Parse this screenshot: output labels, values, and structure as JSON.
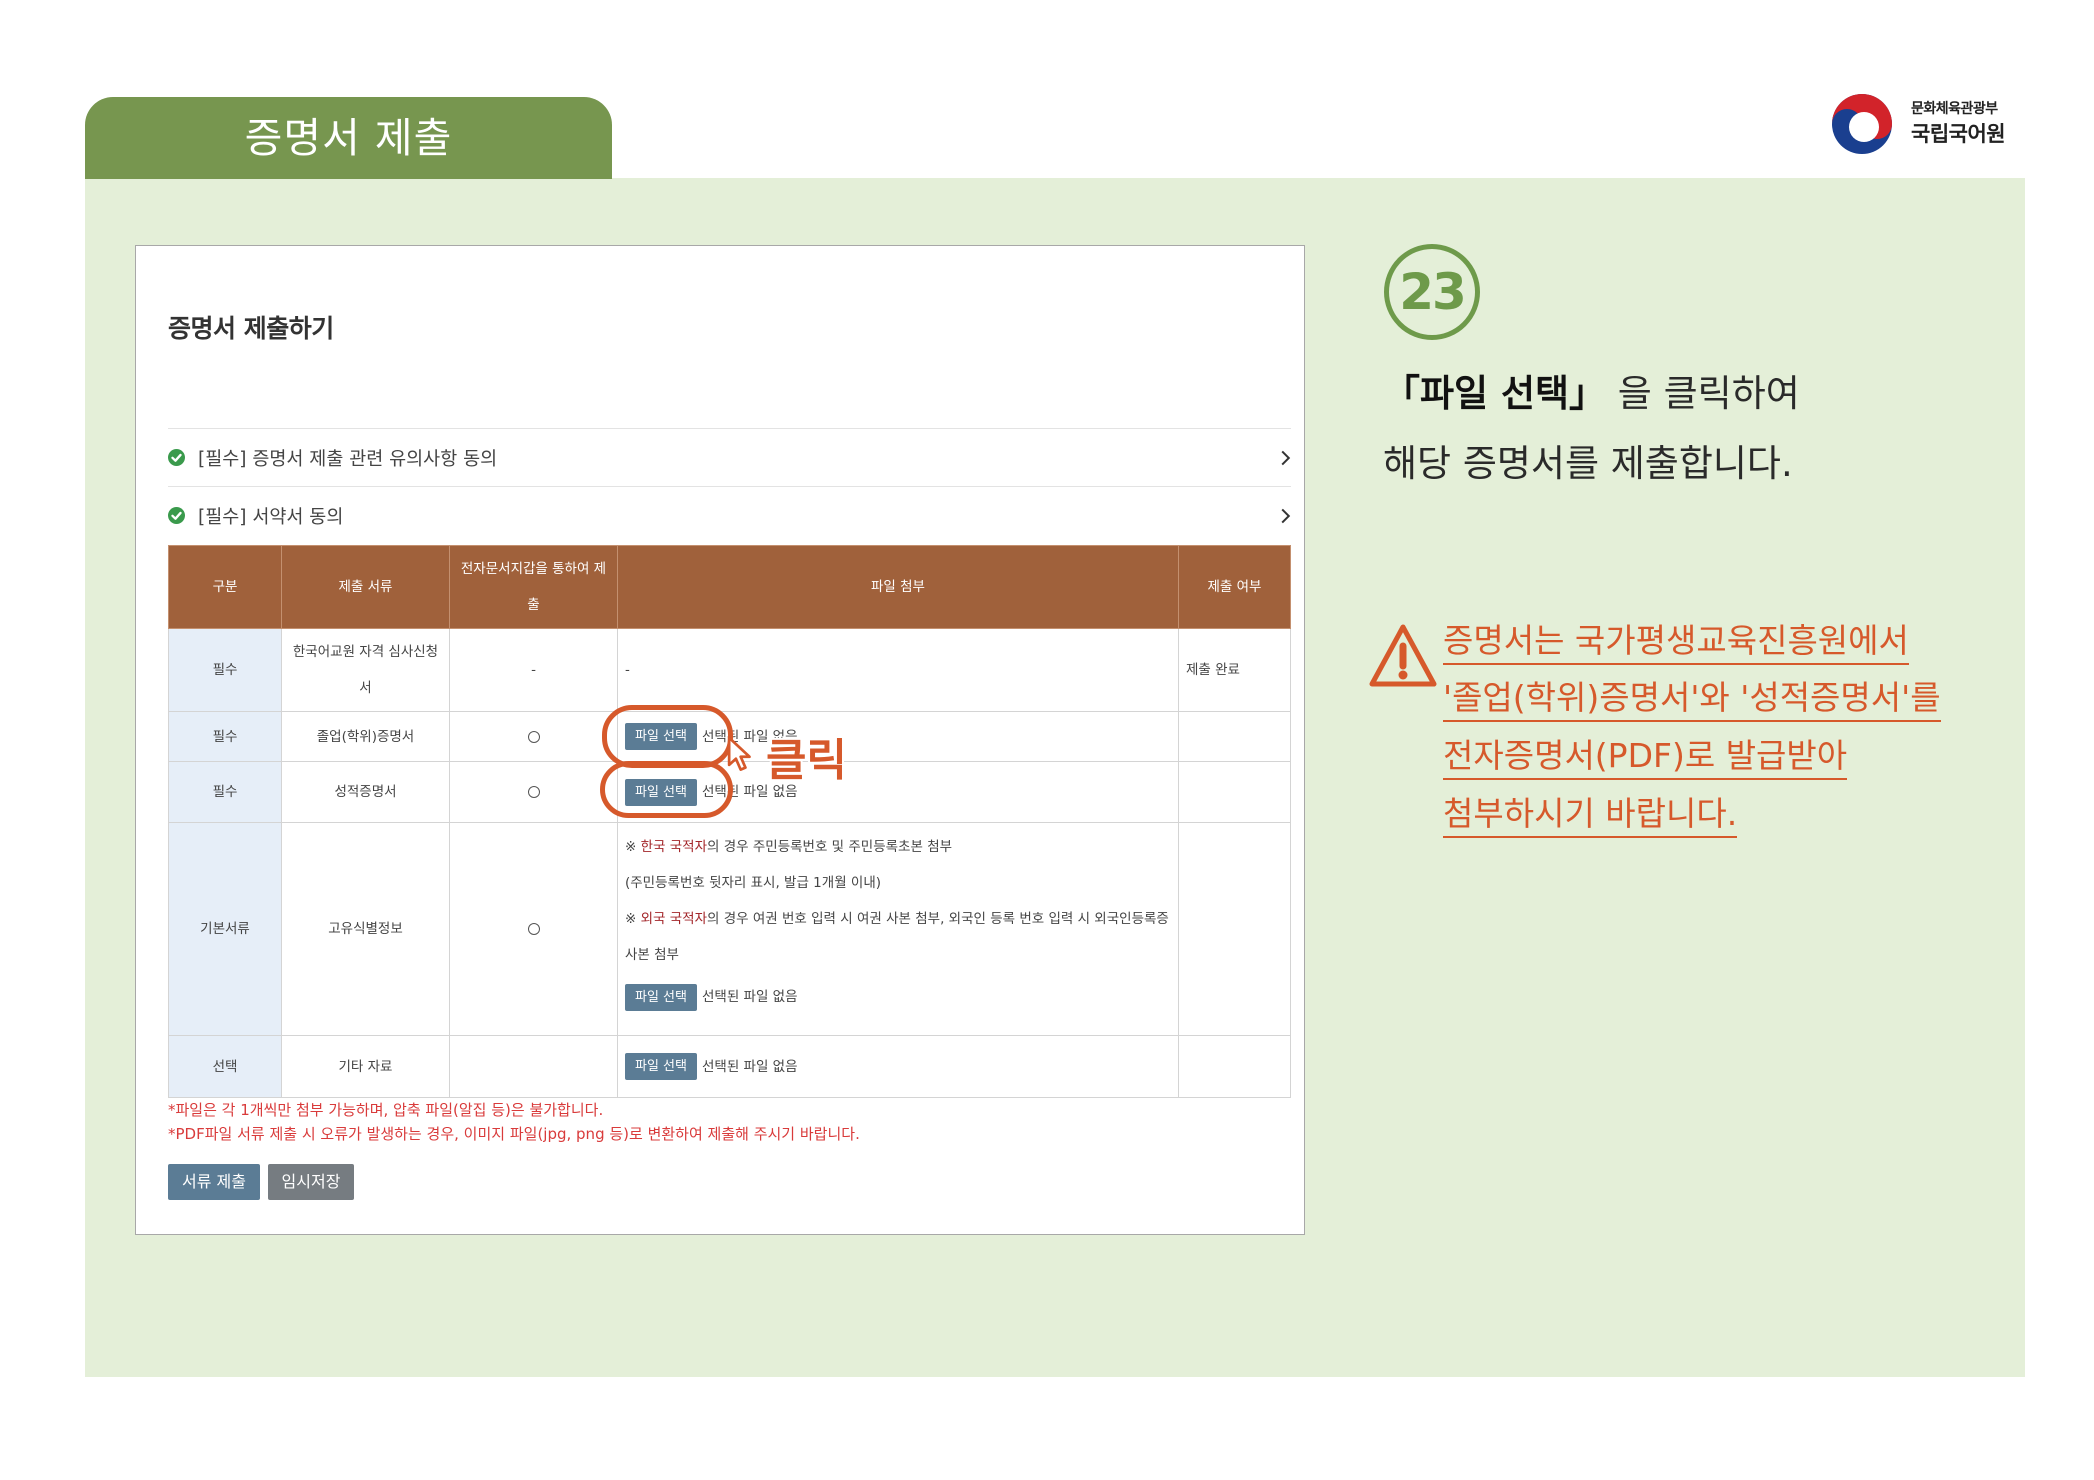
{
  "header": {
    "title": "증명서 제출"
  },
  "logo": {
    "ministry": "문화체육관광부",
    "institute": "국립국어원",
    "icon": "government-emblem-icon"
  },
  "screenshot": {
    "heading": "증명서 제출하기",
    "agreements": [
      {
        "label": "[필수] 증명서 제출 관련 유의사항 동의",
        "icon": "check-circle-icon"
      },
      {
        "label": "[필수] 서약서 동의",
        "icon": "check-circle-icon"
      }
    ],
    "table": {
      "headers": [
        "구분",
        "제출 서류",
        "전자문서지갑을 통하여 제출",
        "파일 첨부",
        "제출 여부"
      ],
      "rows": [
        {
          "category": "필수",
          "document": "한국어교원 자격 심사신청서",
          "wallet": "-",
          "attachment": "-",
          "status": "제출 완료"
        },
        {
          "category": "필수",
          "document": "졸업(학위)증명서",
          "wallet_selected": false,
          "file_button": "파일 선택",
          "file_status": "선택된 파일 없음"
        },
        {
          "category": "필수",
          "document": "성적증명서",
          "wallet_selected": false,
          "file_button": "파일 선택",
          "file_status": "선택된 파일 없음"
        },
        {
          "category": "기본서류",
          "document": "고유식별정보",
          "wallet_selected": false,
          "notes": [
            {
              "prefix": "※ ",
              "highlight": "한국 국적자",
              "rest": "의 경우 주민등록번호 및 주민등록초본 첨부"
            },
            {
              "text": "(주민등록번호 뒷자리 표시, 발급 1개월 이내)"
            },
            {
              "prefix": "※ ",
              "highlight": "외국 국적자",
              "rest": "의 경우 여권 번호 입력 시 여권 사본 첨부, 외국인 등록 번호 입력 시 외국인등록증 사본 첨부"
            }
          ],
          "file_button": "파일 선택",
          "file_status": "선택된 파일 없음"
        },
        {
          "category": "선택",
          "document": "기타 자료",
          "file_button": "파일 선택",
          "file_status": "선택된 파일 없음"
        }
      ]
    },
    "notices": [
      "*파일은 각 1개씩만 첨부 가능하며, 압축 파일(알집 등)은 불가합니다.",
      "*PDF파일 서류 제출 시 오류가 발생하는 경우, 이미지 파일(jpg, png 등)로 변환하여 제출해 주시기 바랍니다."
    ],
    "buttons": {
      "submit": "서류 제출",
      "save": "임시저장"
    }
  },
  "annotation": {
    "click_label": "클릭",
    "cursor_icon": "mouse-pointer-icon"
  },
  "instruction": {
    "step": "23",
    "emphasis": "「파일 선택」",
    "line1_rest": " 을 클릭하여",
    "line2": "해당 증명서를 제출합니다."
  },
  "caution": {
    "icon": "warning-triangle-icon",
    "lines": [
      "증명서는 국가평생교육진흥원에서",
      "'졸업(학위)증명서'와 '성적증명서'를",
      "전자증명서(PDF)로 발급받아",
      "첨부하시기 바랍니다."
    ]
  },
  "colors": {
    "accent_green": "#77964f",
    "panel_bg": "#e4efd8",
    "table_header": "#a0613b",
    "orange": "#d6592b",
    "button_blue": "#5b7c95",
    "button_gray": "#767c81",
    "notice_red": "#d93b3b",
    "highlight_red": "#a3262a",
    "first_col_bg": "#e6eef8",
    "check_green": "#3a9a4c",
    "step_green": "#6e9a4a"
  }
}
